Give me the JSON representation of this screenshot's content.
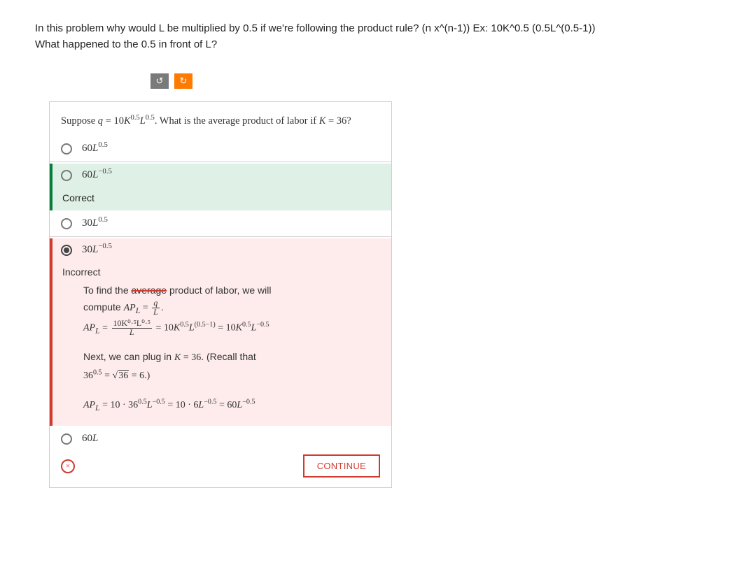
{
  "header": {
    "line1": "In this problem why would L be multiplied by 0.5 if we're following the product rule? (n x^(n-1)) Ex: 10K^0.5 (0.5L^(0.5-1))",
    "line2": "What happened to the 0.5 in front of L?"
  },
  "toolbar": {
    "undo_glyph": "↺",
    "redo_glyph": "↻"
  },
  "prompt": {
    "prefix": "Suppose ",
    "eq_var": "q",
    "eq_eq": " = ",
    "eq_rhs_a": "10",
    "eq_rhs_k": "K",
    "eq_exp1": "0.5",
    "eq_rhs_l": "L",
    "eq_exp2": "0.5",
    "tail": ". What is the average product of labor if ",
    "k_var": "K",
    "k_eq": " = 36?"
  },
  "options": {
    "o1": {
      "coeff": "60",
      "var": "L",
      "exp": "0.5"
    },
    "o2": {
      "coeff": "60",
      "var": "L",
      "exp": "−0.5"
    },
    "o3": {
      "coeff": "30",
      "var": "L",
      "exp": "0.5"
    },
    "o4": {
      "coeff": "30",
      "var": "L",
      "exp": "−0.5"
    },
    "o5": {
      "coeff": "60",
      "var": "L"
    }
  },
  "feedback": {
    "correct_label": "Correct",
    "incorrect_label": "Incorrect"
  },
  "explanation": {
    "l1_a": "To find the ",
    "l1_strike": "average",
    "l1_b": " product of labor, we will",
    "l2_a": "compute ",
    "l2_apl": "AP",
    "l2_sub": "L",
    "l2_eq": " = ",
    "l2_frac_num": "q",
    "l2_frac_den": "L",
    "l2_dot": ".",
    "l3_apl": "AP",
    "l3_sub": "L",
    "l3_eq": " = ",
    "l3_f_num": "10K⁰·⁵L⁰·⁵",
    "l3_f_den": "L",
    "l3_mid": " = 10",
    "l3_k": "K",
    "l3_e1": "0.5",
    "l3_l": "L",
    "l3_e2": "(0.5−1)",
    "l3_eq2": " = 10",
    "l3_k2": "K",
    "l3_e3": "0.5",
    "l3_l2": "L",
    "l3_e4": "−0.5",
    "l4_a": "Next, we can plug in ",
    "l4_k": "K",
    "l4_eq": " = 36",
    "l4_b": ". (Recall that ",
    "l5_a": "36",
    "l5_e": "0.5",
    "l5_eq": " = ",
    "l5_sqrt": "36",
    "l5_eq2": " = 6",
    "l5_b": ".)",
    "l6_apl": "AP",
    "l6_sub": "L",
    "l6_eq": " = 10 · 36",
    "l6_e1": "0.5",
    "l6_l": "L",
    "l6_e2": "−0.5",
    "l6_eq2": " = 10 · 6",
    "l6_l2": "L",
    "l6_e3": "−0.5",
    "l6_eq3": " = 60",
    "l6_l3": "L",
    "l6_e4": "−0.5"
  },
  "footer": {
    "close_glyph": "×",
    "continue_label": "CONTINUE"
  }
}
